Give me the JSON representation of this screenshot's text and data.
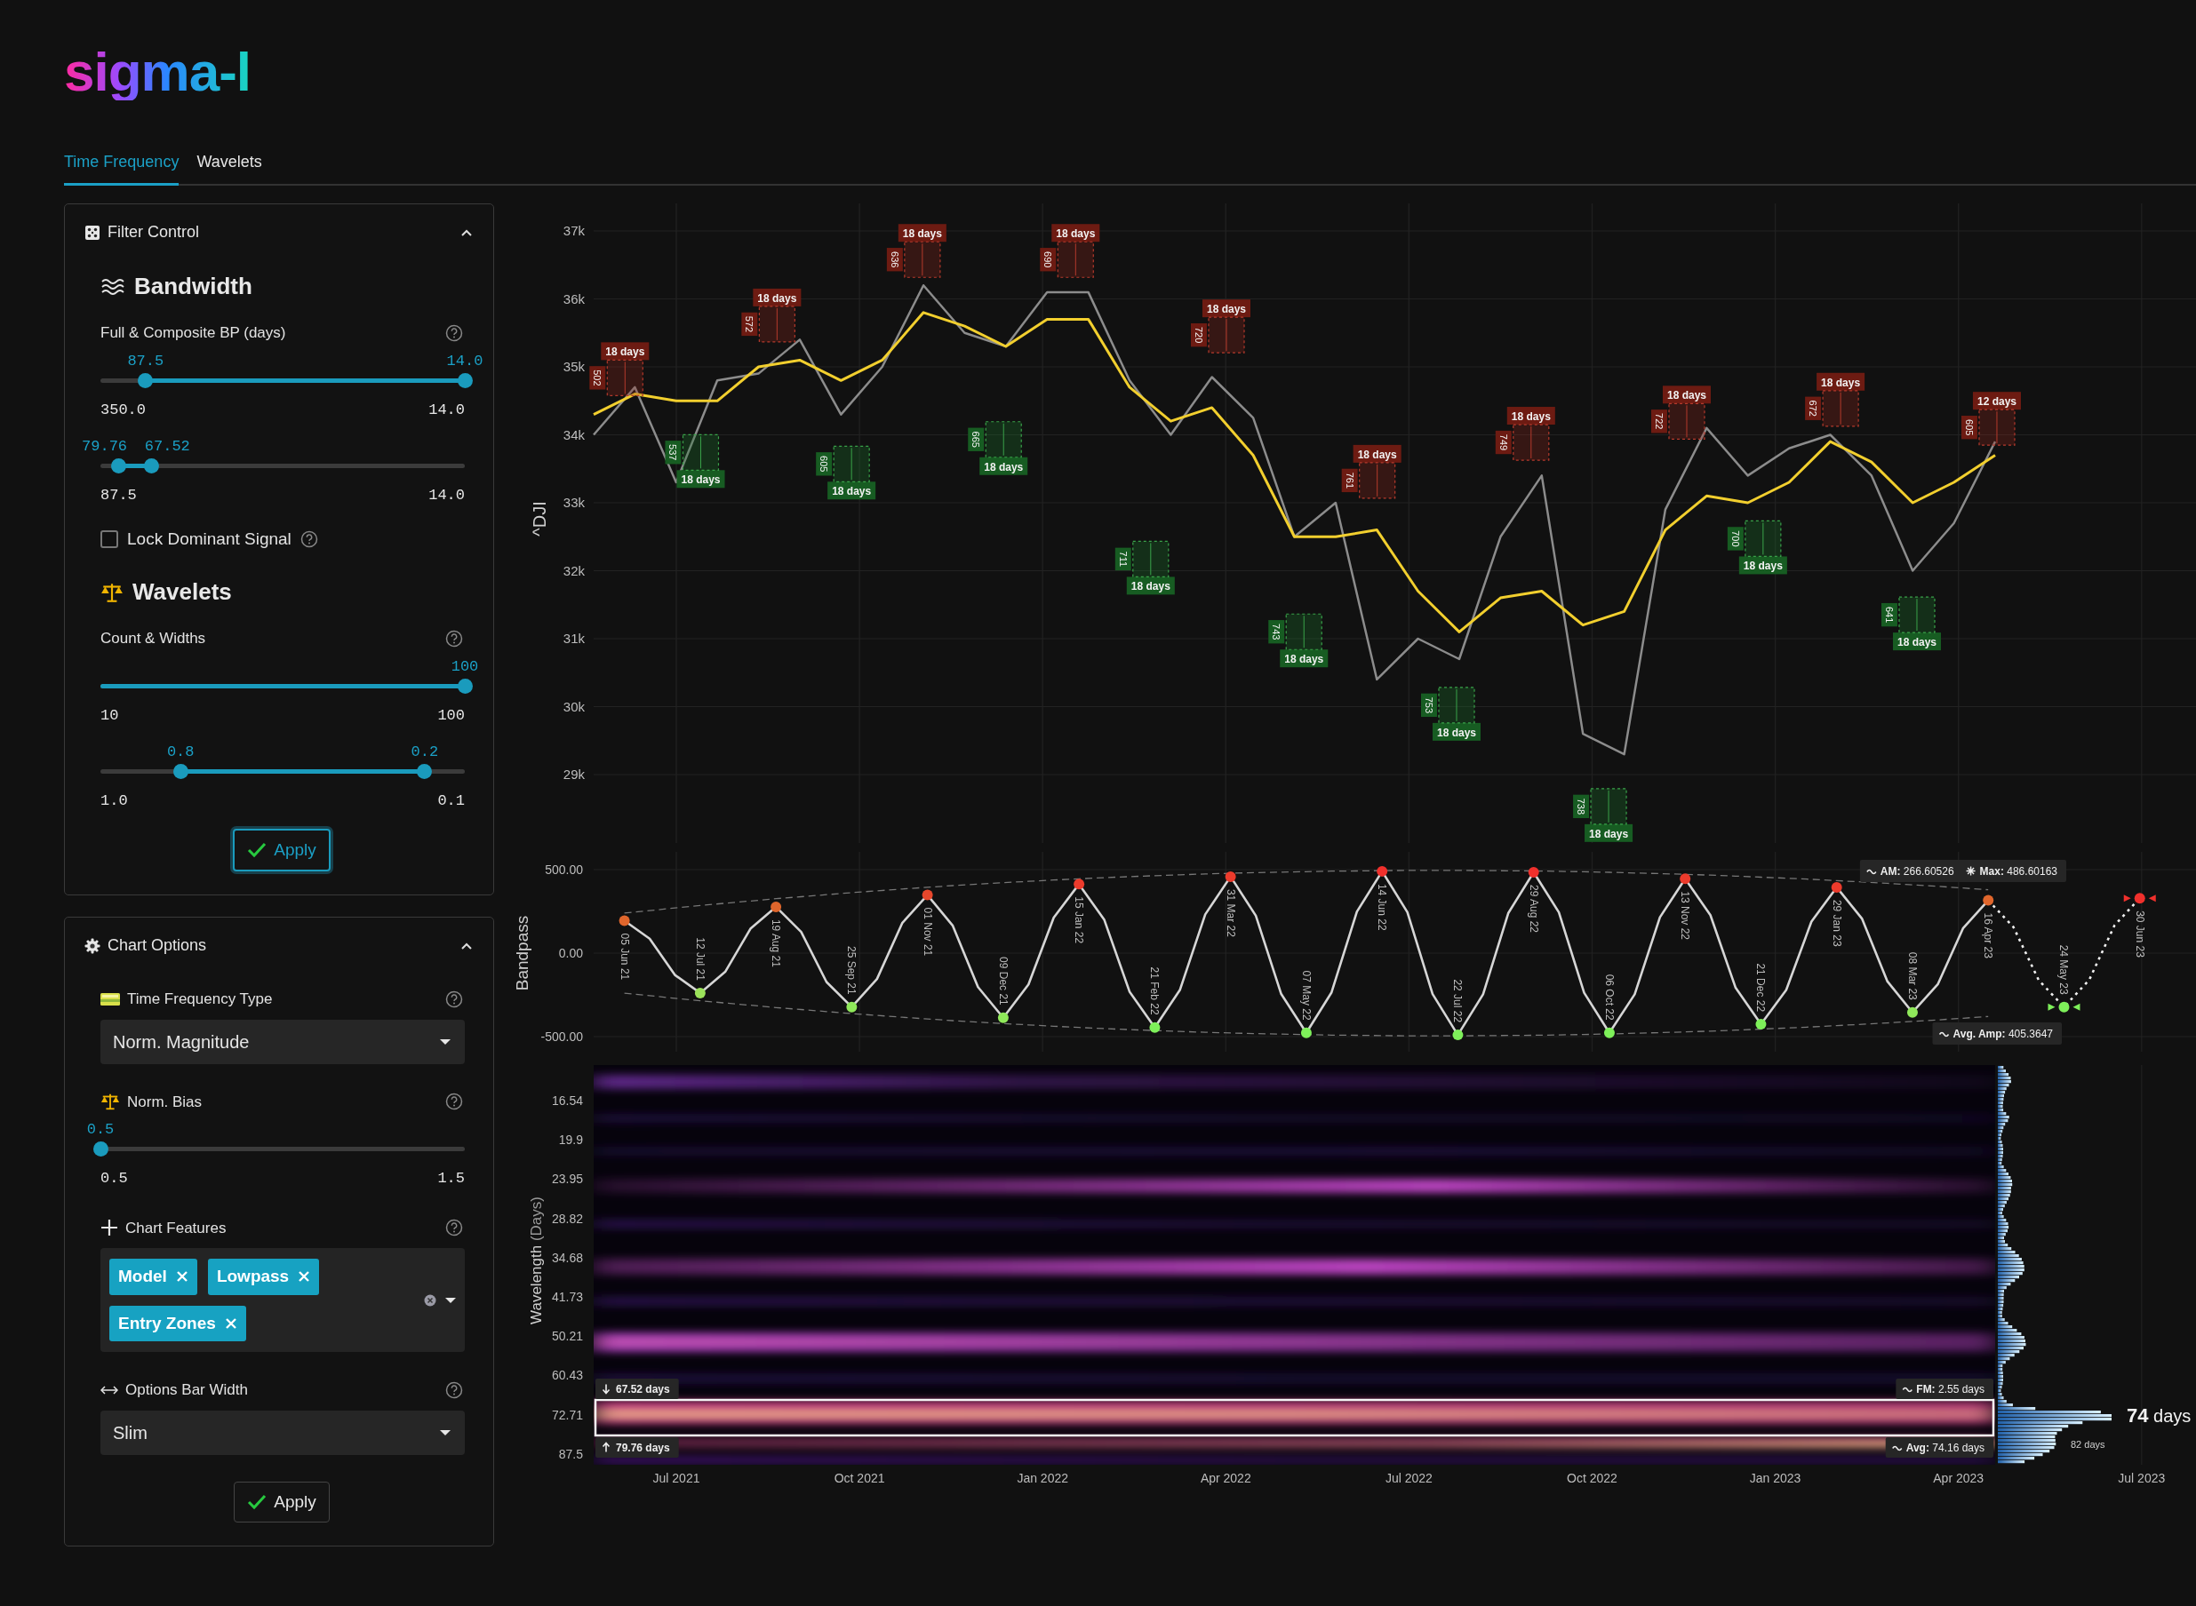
{
  "logo": "sigma-l",
  "tabs": [
    {
      "label": "Time Frequency",
      "selected": true
    },
    {
      "label": "Wavelets",
      "selected": false
    }
  ],
  "filter_control": {
    "title": "Filter Control",
    "expanded": true,
    "bandwidth": {
      "heading": "Bandwidth",
      "label": "Full & Composite BP (days)",
      "sliders": [
        {
          "handles": [
            {
              "value": "87.5",
              "level": 0.124
            },
            {
              "value": "14.0",
              "level": 1.0
            }
          ],
          "min_label": "350.0",
          "max_label": "14.0"
        },
        {
          "handles": [
            {
              "value": "79.76",
              "level": 0.049
            },
            {
              "value": "67.52",
              "level": 0.141
            }
          ],
          "min_label": "87.5",
          "max_label": "14.0"
        }
      ],
      "lock_checkbox": {
        "label": "Lock Dominant Signal",
        "checked": false
      }
    },
    "wavelets": {
      "heading": "Wavelets",
      "label": "Count & Widths",
      "sliders": [
        {
          "handles": [
            {
              "value": "100",
              "level": 1.0
            }
          ],
          "min_label": "10",
          "max_label": "100"
        },
        {
          "handles": [
            {
              "value": "0.8",
              "level": 0.22
            },
            {
              "value": "0.2",
              "level": 0.89
            }
          ],
          "min_label": "1.0",
          "max_label": "0.1"
        }
      ]
    },
    "apply": {
      "label": "Apply",
      "focused": true
    }
  },
  "chart_options": {
    "title": "Chart Options",
    "expanded": true,
    "fields": [
      {
        "kind": "select",
        "label": "Time Frequency Type",
        "value": "Norm. Magnitude"
      },
      {
        "kind": "slider",
        "label": "Norm. Bias",
        "slider": {
          "handles": [
            {
              "value": "0.5",
              "level": 0.0
            }
          ],
          "min_label": "0.5",
          "max_label": "1.5"
        }
      },
      {
        "kind": "tags",
        "label": "Chart Features",
        "tags": [
          "Model",
          "Lowpass",
          "Entry Zones"
        ]
      },
      {
        "kind": "select",
        "label": "Options Bar Width",
        "value": "Slim"
      }
    ],
    "apply": {
      "label": "Apply",
      "focused": false
    }
  },
  "price_chart": {
    "chart_data": {
      "type": "line",
      "ylabel": "^DJI",
      "ylim": [
        29000,
        37000
      ],
      "grid": true,
      "yticks": [
        {
          "value": 29000,
          "label": "29k"
        },
        {
          "value": 30000,
          "label": "30k"
        },
        {
          "value": 31000,
          "label": "31k"
        },
        {
          "value": 32000,
          "label": "32k"
        },
        {
          "value": 33000,
          "label": "33k"
        },
        {
          "value": 34000,
          "label": "34k"
        },
        {
          "value": 35000,
          "label": "35k"
        },
        {
          "value": 36000,
          "label": "36k"
        },
        {
          "value": 37000,
          "label": "37k"
        }
      ],
      "categories": [
        null,
        null,
        null,
        null,
        null,
        null,
        null,
        null,
        null,
        null,
        null,
        null,
        null,
        null,
        null,
        null,
        null,
        null,
        null,
        null,
        null,
        null,
        null,
        null,
        null,
        null,
        null,
        null,
        null,
        null,
        null,
        null,
        null,
        null,
        null
      ],
      "series": [
        {
          "color": "#8c8c8c",
          "line_style": "solid",
          "values": [
            34000,
            34700,
            33300,
            34800,
            34900,
            35400,
            34300,
            35000,
            36200,
            35500,
            35300,
            36100,
            36100,
            34800,
            34000,
            34850,
            34250,
            32500,
            33000,
            30400,
            31000,
            30700,
            32500,
            33400,
            29600,
            29300,
            32900,
            34100,
            33400,
            33800,
            34000,
            33400,
            32000,
            32700,
            33900
          ]
        },
        {
          "color": "#f2cf2e",
          "line_style": "solid",
          "values": [
            34300,
            34600,
            34500,
            34500,
            35000,
            35100,
            34800,
            35100,
            35800,
            35600,
            35300,
            35700,
            35700,
            34700,
            34200,
            34400,
            33700,
            32500,
            32500,
            32600,
            31700,
            31100,
            31600,
            31700,
            31200,
            31400,
            32600,
            33100,
            33000,
            33300,
            33900,
            33600,
            33000,
            33300,
            33700
          ]
        }
      ]
    },
    "entry_zones": [
      {
        "kind": "peak",
        "duration": "18 days",
        "count": "502"
      },
      {
        "kind": "trough",
        "duration": "18 days",
        "count": "537"
      },
      {
        "kind": "peak",
        "duration": "18 days",
        "count": "572"
      },
      {
        "kind": "trough",
        "duration": "18 days",
        "count": "605"
      },
      {
        "kind": "peak",
        "duration": "18 days",
        "count": "636"
      },
      {
        "kind": "trough",
        "duration": "18 days",
        "count": "665"
      },
      {
        "kind": "peak",
        "duration": "18 days",
        "count": "690"
      },
      {
        "kind": "trough",
        "duration": "18 days",
        "count": "711"
      },
      {
        "kind": "peak",
        "duration": "18 days",
        "count": "720"
      },
      {
        "kind": "trough",
        "duration": "18 days",
        "count": "743"
      },
      {
        "kind": "peak",
        "duration": "18 days",
        "count": "761"
      },
      {
        "kind": "trough",
        "duration": "18 days",
        "count": "753"
      },
      {
        "kind": "peak",
        "duration": "18 days",
        "count": "749"
      },
      {
        "kind": "trough",
        "duration": "18 days",
        "count": "738"
      },
      {
        "kind": "peak",
        "duration": "18 days",
        "count": "722"
      },
      {
        "kind": "trough",
        "duration": "18 days",
        "count": "700"
      },
      {
        "kind": "peak",
        "duration": "18 days",
        "count": "672"
      },
      {
        "kind": "trough",
        "duration": "18 days",
        "count": "641"
      },
      {
        "kind": "peak",
        "duration": "12 days",
        "count": "605"
      }
    ]
  },
  "bandpass": {
    "chart_data": {
      "type": "line",
      "ylabel": "Bandpass",
      "ylim": [
        -500,
        500
      ],
      "grid": true,
      "yticks": [
        {
          "value": 500,
          "label": "500.00"
        },
        {
          "value": 0,
          "label": "0.00"
        },
        {
          "value": -500,
          "label": "-500.00"
        }
      ],
      "categories": [
        null,
        null,
        null,
        null,
        null,
        null,
        null,
        null,
        null,
        null,
        null,
        null,
        null,
        null,
        null,
        null,
        null,
        null,
        null,
        null,
        null,
        null,
        null,
        null,
        null,
        null,
        null,
        null,
        null,
        null,
        null,
        null,
        null,
        null,
        null,
        null,
        null,
        null,
        null,
        null,
        null,
        null,
        null,
        null,
        null,
        null,
        null,
        null,
        null,
        null,
        null,
        null,
        null,
        null,
        null,
        null,
        null,
        null,
        null,
        null,
        null
      ],
      "series": [
        {
          "color": "#d6d6d6",
          "line_style": "solid",
          "values": [
            194,
            86,
            -131,
            -239,
            -110,
            148,
            277,
            127,
            -173,
            -323,
            -155,
            180,
            348,
            164,
            -203,
            -387,
            -187,
            213,
            413,
            199,
            -231,
            -445,
            -219,
            232,
            458,
            224,
            -243,
            -477,
            -235,
            248,
            490,
            245,
            -245,
            -490,
            -247,
            241,
            484,
            244,
            -237,
            -477,
            -247,
            215,
            445,
            227,
            -208,
            -426,
            -221,
            189,
            394,
            207,
            -168,
            -355,
            -187,
            148,
            316,
            null,
            null,
            null,
            null,
            null,
            null
          ]
        },
        {
          "color": "#f0f0f0",
          "line_style": "dotted",
          "values": [
            null,
            null,
            null,
            null,
            null,
            null,
            null,
            null,
            null,
            null,
            null,
            null,
            null,
            null,
            null,
            null,
            null,
            null,
            null,
            null,
            null,
            null,
            null,
            null,
            null,
            null,
            null,
            null,
            null,
            null,
            null,
            null,
            null,
            null,
            null,
            null,
            null,
            null,
            null,
            null,
            null,
            null,
            null,
            null,
            null,
            null,
            null,
            null,
            null,
            null,
            null,
            null,
            null,
            null,
            316,
            156,
            -163,
            -323,
            -160,
            166,
            329
          ]
        },
        {
          "color": "#777777",
          "line_style": "dashed",
          "values": [
            240,
            255,
            270,
            285,
            299,
            312,
            326,
            338,
            350,
            362,
            373,
            384,
            394,
            404,
            413,
            422,
            430,
            438,
            445,
            452,
            458,
            464,
            469,
            474,
            478,
            482,
            485,
            488,
            491,
            492,
            494,
            495,
            495,
            495,
            494,
            493,
            492,
            490,
            487,
            484,
            480,
            476,
            472,
            467,
            461,
            455,
            449,
            442,
            434,
            426,
            418,
            409,
            400,
            390,
            379,
            null,
            null,
            null,
            null,
            null,
            null
          ]
        },
        {
          "color": "#777777",
          "line_style": "dashed",
          "values": [
            -240,
            -255,
            -270,
            -285,
            -299,
            -312,
            -326,
            -338,
            -350,
            -362,
            -373,
            -384,
            -394,
            -404,
            -413,
            -422,
            -430,
            -438,
            -445,
            -452,
            -458,
            -464,
            -469,
            -474,
            -478,
            -482,
            -485,
            -488,
            -491,
            -492,
            -494,
            -495,
            -495,
            -495,
            -494,
            -493,
            -492,
            -490,
            -487,
            -484,
            -480,
            -476,
            -472,
            -467,
            -461,
            -455,
            -449,
            -442,
            -434,
            -426,
            -418,
            -409,
            -400,
            -390,
            -379,
            null,
            null,
            null,
            null,
            null,
            null
          ]
        }
      ]
    },
    "turning_points": [
      {
        "text": "05 Jun 21",
        "kind": "peak",
        "color": "#e0662c",
        "projected": false
      },
      {
        "text": "12 Jul 21",
        "kind": "trough",
        "color": "#9be25a",
        "projected": false
      },
      {
        "text": "19 Aug 21",
        "kind": "peak",
        "color": "#e0662c",
        "projected": false
      },
      {
        "text": "25 Sep 21",
        "kind": "trough",
        "color": "#8fe85a",
        "projected": false
      },
      {
        "text": "01 Nov 21",
        "kind": "peak",
        "color": "#e8472c",
        "projected": false
      },
      {
        "text": "09 Dec 21",
        "kind": "trough",
        "color": "#8fe85a",
        "projected": false
      },
      {
        "text": "15 Jan 22",
        "kind": "peak",
        "color": "#ec3b2c",
        "projected": false
      },
      {
        "text": "21 Feb 22",
        "kind": "trough",
        "color": "#7ef05a",
        "projected": false
      },
      {
        "text": "31 Mar 22",
        "kind": "peak",
        "color": "#ec3b2c",
        "projected": false
      },
      {
        "text": "07 May 22",
        "kind": "trough",
        "color": "#7ef05a",
        "projected": false
      },
      {
        "text": "14 Jun 22",
        "kind": "peak",
        "color": "#f0302c",
        "projected": false
      },
      {
        "text": "22 Jul 22",
        "kind": "trough",
        "color": "#7ef05a",
        "projected": false
      },
      {
        "text": "29 Aug 22",
        "kind": "peak",
        "color": "#f0302c",
        "projected": false
      },
      {
        "text": "06 Oct 22",
        "kind": "trough",
        "color": "#7ef05a",
        "projected": false
      },
      {
        "text": "13 Nov 22",
        "kind": "peak",
        "color": "#ec3b2c",
        "projected": false
      },
      {
        "text": "21 Dec 22",
        "kind": "trough",
        "color": "#7ef05a",
        "projected": false
      },
      {
        "text": "29 Jan 23",
        "kind": "peak",
        "color": "#ec3b2c",
        "projected": false
      },
      {
        "text": "08 Mar 23",
        "kind": "trough",
        "color": "#8fe85a",
        "projected": false
      },
      {
        "text": "16 Apr 23",
        "kind": "peak",
        "color": "#e0662c",
        "projected": false
      },
      {
        "text": "24 May 23",
        "kind": "trough",
        "color": "#7ef05a",
        "projected": true
      },
      {
        "text": "30 Jun 23",
        "kind": "peak",
        "color": "#f0302c",
        "projected": true
      }
    ],
    "readouts": [
      {
        "label": "AM:",
        "value": "266.60526"
      },
      {
        "label": "Max:",
        "value": "486.60163"
      },
      {
        "label": "Avg. Amp:",
        "value": "405.3647"
      }
    ]
  },
  "spectrogram": {
    "ylabel": "Wavelength",
    "ylabel_unit": "(Days)",
    "yticks": [
      "16.54",
      "19.9",
      "23.95",
      "28.82",
      "34.68",
      "41.73",
      "50.21",
      "60.43",
      "72.71",
      "87.5"
    ],
    "band": {
      "lower": "67.52 days",
      "upper": "79.76 days"
    },
    "readouts": [
      {
        "label": "FM:",
        "value": "2.55 days"
      },
      {
        "label": "Avg:",
        "value": "74.16 days"
      }
    ],
    "peak": {
      "value": "74",
      "unit": "days"
    },
    "secondary_peak": "82 days"
  },
  "time_axis": [
    "Jul 2021",
    "Oct 2021",
    "Jan 2022",
    "Apr 2022",
    "Jul 2022",
    "Oct 2022",
    "Jan 2023",
    "Apr 2023",
    "Jul 2023"
  ]
}
